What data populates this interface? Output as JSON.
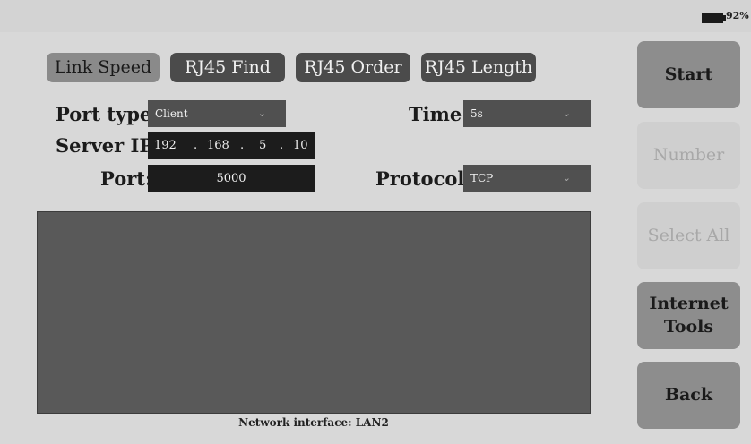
{
  "status": {
    "battery_percent": "92%"
  },
  "tabs": [
    {
      "label": "Link Speed",
      "active": true
    },
    {
      "label": "RJ45 Find",
      "active": false
    },
    {
      "label": "RJ45 Order",
      "active": false
    },
    {
      "label": "RJ45 Length",
      "active": false
    }
  ],
  "form": {
    "port_type_label": "Port type:",
    "port_type_value": "Client",
    "time_label": "Time:",
    "time_value": "5s",
    "server_ip_label": "Server IP:",
    "ip": [
      "192",
      ".",
      "168",
      ".",
      "5",
      ".",
      "10"
    ],
    "port_label": "Port:",
    "port_value": "5000",
    "protocol_label": "Protocol:",
    "protocol_value": "TCP"
  },
  "footer": {
    "network_interface": "Network interface: LAN2"
  },
  "side_buttons": [
    {
      "label": "Start",
      "enabled": true
    },
    {
      "label": "Number",
      "enabled": false
    },
    {
      "label": "Select All",
      "enabled": false
    },
    {
      "label": "Internet Tools",
      "enabled": true
    },
    {
      "label": "Back",
      "enabled": true
    }
  ],
  "colors": {
    "background": "#d8d8d8",
    "button_active": "#8d8d8d",
    "tab": "#4b4b4b",
    "output_panel": "#595959"
  }
}
